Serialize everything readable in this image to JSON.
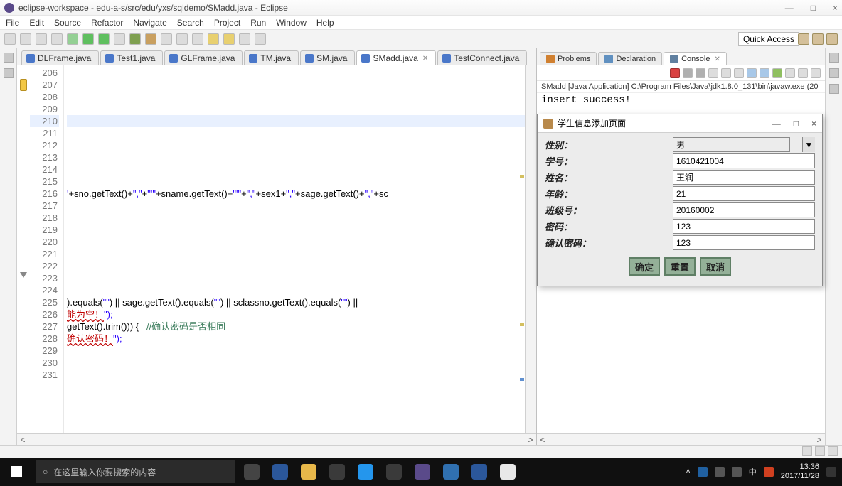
{
  "title": "eclipse-workspace - edu-a-s/src/edu/yxs/sqldemo/SMadd.java - Eclipse",
  "menu": [
    "File",
    "Edit",
    "Source",
    "Refactor",
    "Navigate",
    "Search",
    "Project",
    "Run",
    "Window",
    "Help"
  ],
  "quick_access": "Quick Access",
  "editor_tabs": [
    {
      "label": "DLFrame.java",
      "active": false
    },
    {
      "label": "Test1.java",
      "active": false
    },
    {
      "label": "GLFrame.java",
      "active": false
    },
    {
      "label": "TM.java",
      "active": false
    },
    {
      "label": "SM.java",
      "active": false
    },
    {
      "label": "SMadd.java",
      "active": true
    },
    {
      "label": "TestConnect.java",
      "active": false
    }
  ],
  "lines": {
    "start": 206,
    "end": 231,
    "current": 210,
    "markers": {
      "207": "warn",
      "212": "fold",
      "223": "tri"
    },
    "code": {
      "216": {
        "pre": "'",
        "mid": "+sno.getText()+",
        "s1": "\",\"",
        "mid2": "+",
        "s2": "\"'\"",
        "mid3": "+sname.getText()+",
        "s3": "\"'\"",
        "mid4": "+",
        "s4": "\",\"",
        "mid5": "+sex1+",
        "s5": "\",\"",
        "mid6": "+sage.getText()+",
        "s6": "\",\"",
        "mid7": "+sc"
      },
      "225": {
        "pre": ").equals(",
        "s1": "\"\"",
        "mid": ") || sage.getText().equals(",
        "s2": "\"\"",
        "mid2": ") || sclassno.getText().equals(",
        "s3": "\"\"",
        "mid3": ") ||"
      },
      "226": {
        "err": "能为空！",
        "s": "\");"
      },
      "227": {
        "pre": "getText().trim())) {   ",
        "cmt": "//确认密码是否相同"
      },
      "228": {
        "err": "确认密码！",
        "s": "\");"
      }
    }
  },
  "side_tabs": [
    {
      "label": "Problems",
      "active": false,
      "color": "#d08030"
    },
    {
      "label": "Declaration",
      "active": false,
      "color": "#6090c0"
    },
    {
      "label": "Console",
      "active": true,
      "color": "#6080a0"
    }
  ],
  "console_launch": "SMadd [Java Application] C:\\Program Files\\Java\\jdk1.8.0_131\\bin\\javaw.exe (20",
  "console_output": "insert success!",
  "dialog": {
    "title": "学生信息添加页面",
    "fields": {
      "gender_label": "性别：",
      "gender_value": "男",
      "sno_label": "学号：",
      "sno_value": "1610421004",
      "name_label": "姓名：",
      "name_value": "王润",
      "age_label": "年龄：",
      "age_value": "21",
      "class_label": "班级号：",
      "class_value": "20160002",
      "pwd_label": "密码：",
      "pwd_value": "123",
      "pwd2_label": "确认密码：",
      "pwd2_value": "123"
    },
    "buttons": {
      "ok": "确定",
      "reset": "重置",
      "cancel": "取消"
    }
  },
  "taskbar": {
    "search_placeholder": "在这里输入你要搜索的内容",
    "time": "13:36",
    "date": "2017/11/28"
  }
}
